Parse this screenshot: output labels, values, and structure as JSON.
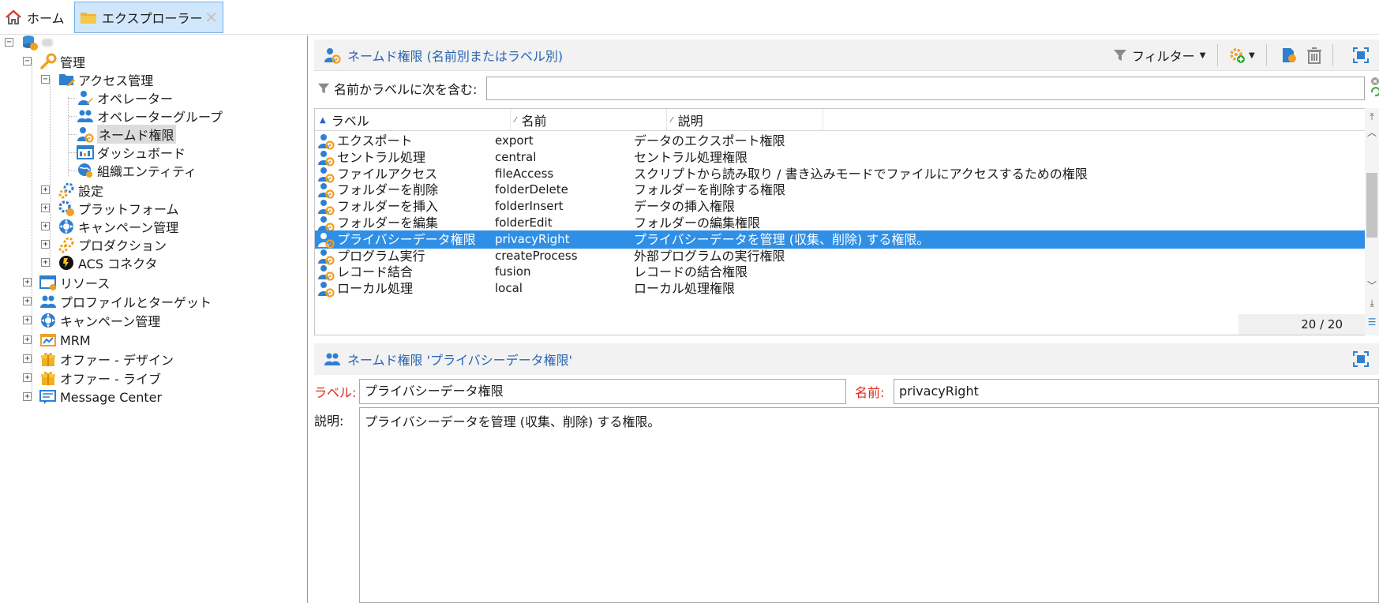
{
  "tabs": [
    {
      "label": "ホーム",
      "icon": "home-icon",
      "active": false
    },
    {
      "label": "エクスプローラー",
      "icon": "folder-icon",
      "active": true,
      "close": "✕"
    }
  ],
  "tree": {
    "root_label": "",
    "admin": "管理",
    "access": "アクセス管理",
    "access_children": [
      "オペレーター",
      "オペレーターグループ",
      "ネームド権限",
      "ダッシュボード",
      "組織エンティティ"
    ],
    "admin_children": [
      "設定",
      "プラットフォーム",
      "キャンペーン管理",
      "プロダクション",
      "ACS コネクタ"
    ],
    "top_children": [
      "リソース",
      "プロファイルとターゲット",
      "キャンペーン管理",
      "MRM",
      "オファー - デザイン",
      "オファー - ライブ",
      "Message Center"
    ],
    "selected": "ネームド権限"
  },
  "list_panel": {
    "title": "ネームド権限 (名前別またはラベル別)",
    "filter_button": "フィルター",
    "filter_label": "名前かラベルに次を含む:",
    "filter_value": "",
    "columns": [
      "ラベル",
      "名前",
      "説明"
    ],
    "rows": [
      {
        "label": "エクスポート",
        "name": "export",
        "desc": "データのエクスポート権限"
      },
      {
        "label": "セントラル処理",
        "name": "central",
        "desc": "セントラル処理権限"
      },
      {
        "label": "ファイルアクセス",
        "name": "fileAccess",
        "desc": "スクリプトから読み取り / 書き込みモードでファイルにアクセスするための権限"
      },
      {
        "label": "フォルダーを削除",
        "name": "folderDelete",
        "desc": "フォルダーを削除する権限"
      },
      {
        "label": "フォルダーを挿入",
        "name": "folderInsert",
        "desc": "データの挿入権限"
      },
      {
        "label": "フォルダーを編集",
        "name": "folderEdit",
        "desc": "フォルダーの編集権限"
      },
      {
        "label": "プライバシーデータ権限",
        "name": "privacyRight",
        "desc": "プライバシーデータを管理 (収集、削除) する権限。",
        "selected": true
      },
      {
        "label": "プログラム実行",
        "name": "createProcess",
        "desc": "外部プログラムの実行権限"
      },
      {
        "label": "レコード結合",
        "name": "fusion",
        "desc": "レコードの結合権限"
      },
      {
        "label": "ローカル処理",
        "name": "local",
        "desc": "ローカル処理権限"
      }
    ],
    "count": "20 / 20"
  },
  "detail_panel": {
    "title": "ネームド権限 'プライバシーデータ権限'",
    "label_caption": "ラベル:",
    "label_value": "プライバシーデータ権限",
    "name_caption": "名前:",
    "name_value": "privacyRight",
    "desc_caption": "説明:",
    "desc_value": "プライバシーデータを管理 (収集、削除) する権限。"
  },
  "colors": {
    "accent_blue": "#2f8fe6",
    "title_blue": "#2864b4",
    "required_red": "#e0261c",
    "icon_orange": "#f0a020"
  }
}
